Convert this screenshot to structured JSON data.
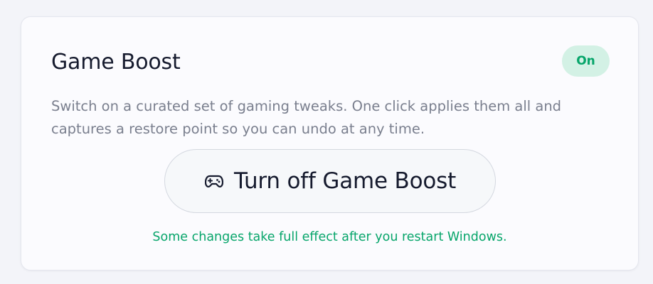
{
  "card": {
    "title": "Game Boost",
    "status_badge": "On",
    "description": "Switch on a curated set of gaming tweaks. One click applies them all and captures a restore point so you can undo at any time.",
    "action_button": {
      "icon": "gamepad-icon",
      "label": "Turn off Game Boost"
    },
    "restart_note": "Some changes take full effect after you restart Windows."
  },
  "colors": {
    "page_background": "#f3f4f9",
    "card_background": "#fbfbfe",
    "accent_green": "#06a56a",
    "badge_background": "#d3f1e5",
    "title_text": "#161b2e",
    "muted_text": "#7a7f8e"
  }
}
